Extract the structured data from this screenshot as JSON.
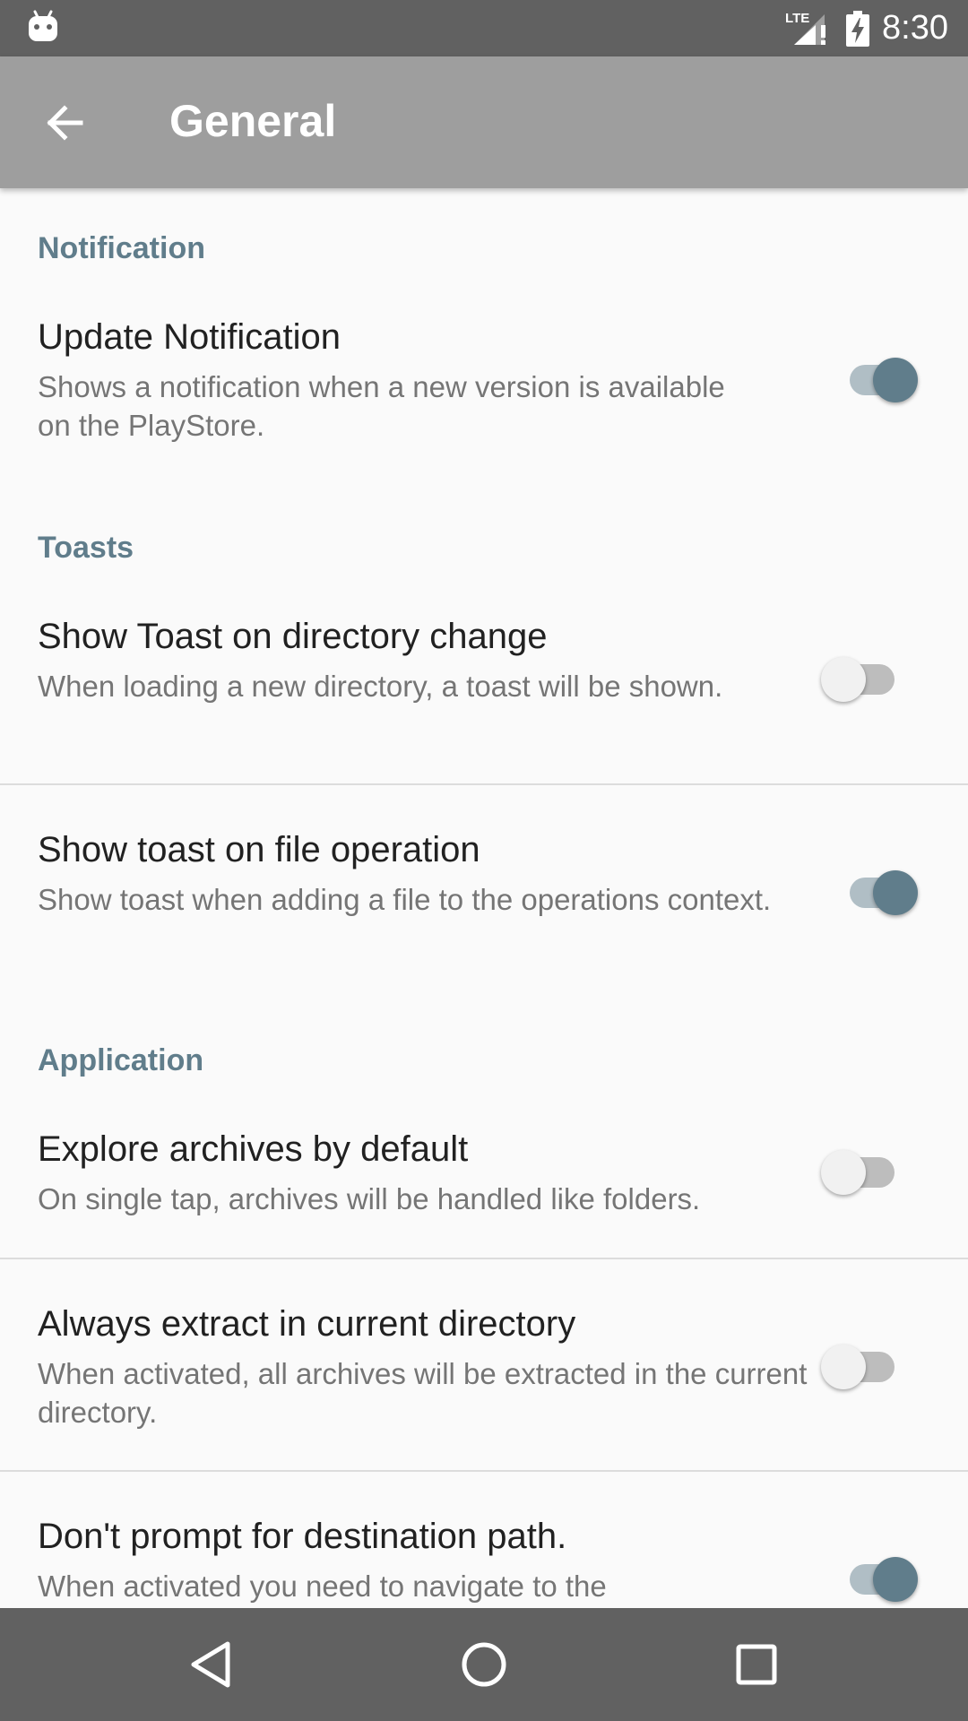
{
  "status_bar": {
    "time": "8:30",
    "network": "LTE",
    "icons": [
      "android-icon",
      "signal-lte-icon",
      "battery-charging-icon"
    ]
  },
  "app_bar": {
    "title": "General",
    "back_icon": "arrow-back-icon"
  },
  "sections": {
    "notification": {
      "header": "Notification",
      "update_notification": {
        "title": "Update Notification",
        "summary": "Shows a notification when a new version is available on the PlayStore.",
        "enabled": true
      }
    },
    "toasts": {
      "header": "Toasts",
      "directory_change": {
        "title": "Show Toast on directory change",
        "summary": "When loading a new directory, a toast will be shown.",
        "enabled": false
      },
      "file_operation": {
        "title": "Show toast on file operation",
        "summary": "Show toast when adding a file to the operations context.",
        "enabled": true
      }
    },
    "application": {
      "header": "Application",
      "explore_archives": {
        "title": "Explore archives by default",
        "summary": "On single tap, archives will be handled like folders.",
        "enabled": false
      },
      "extract_current": {
        "title": "Always extract in current directory",
        "summary": "When activated, all archives will be extracted in the current directory.",
        "enabled": false
      },
      "dont_prompt": {
        "title": "Don't prompt for destination path.",
        "summary": "When activated you need to navigate to the",
        "enabled": true
      }
    }
  },
  "nav_bar": {
    "icons": [
      "back-triangle-icon",
      "home-circle-icon",
      "recents-square-icon"
    ]
  },
  "colors": {
    "accent": "#607d8b",
    "app_bar": "#9e9e9e",
    "status_bar": "#616161",
    "nav_bar": "#616161",
    "background": "#fafafa"
  }
}
